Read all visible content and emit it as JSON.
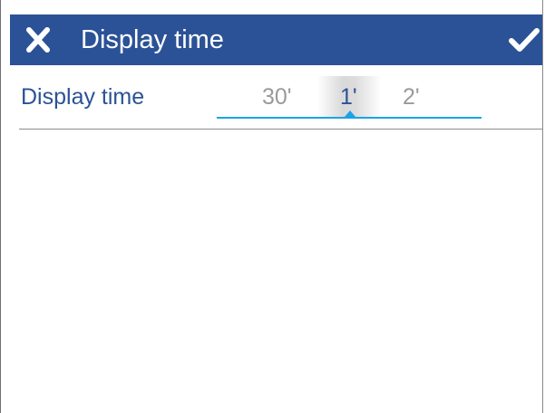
{
  "dialog": {
    "title": "Display time",
    "close_icon": "close-icon",
    "confirm_icon": "checkmark-icon",
    "header_color": "#2b5296"
  },
  "setting": {
    "label": "Display time",
    "options": [
      "30'",
      "1'",
      "2'"
    ],
    "selected": "1'",
    "selected_index": 1,
    "accent_color": "#1aa3e6"
  }
}
